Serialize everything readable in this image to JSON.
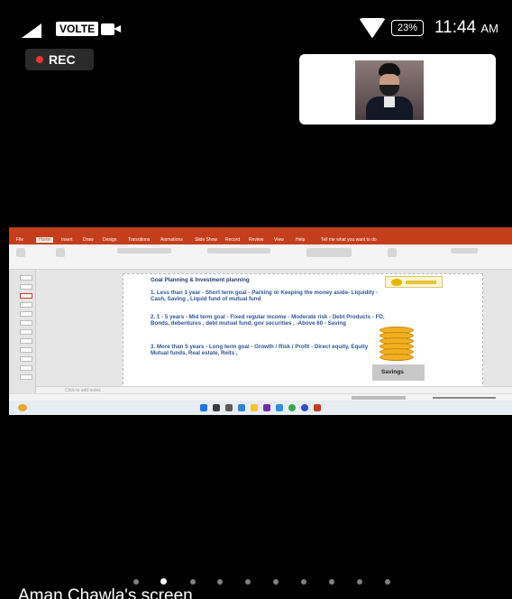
{
  "status_bar": {
    "network_badge": "VOLTE",
    "battery": "23%",
    "time": "11:44",
    "ampm": "AM"
  },
  "recording": {
    "label": "REC",
    "dot_color": "#ee3333"
  },
  "shared_screen": {
    "owner_label": "Aman Chawla's screen",
    "app": {
      "tabs": [
        "File",
        "Home",
        "Insert",
        "Draw",
        "Design",
        "Transitions",
        "Animations",
        "Slide Show",
        "Record",
        "Review",
        "View",
        "Help"
      ],
      "active_tab": "Home",
      "search_hint": "Tell me what you want to do",
      "notes_hint": "Click to add notes",
      "brand_color": "#c43e1c"
    },
    "slide": {
      "title": "Goal Planning & Investment planning",
      "points": [
        "1. Less than 1 year - Short term goal - Parking or Keeping the money aside- Liquidity - Cash, Saving , Liquid fund of mutual fund",
        "2. 1 - 5 years - Mid term goal - Fixed regular income - Moderate risk - Debt Products - FD, Bonds, debentures , debt mutual fund, gov securities , -Above 60 - Saving",
        "3. More than 5 years - Long term goal - Growth / Risk / Profit - Direct equity, Equity Mutual funds, Real estate, Reits ,"
      ],
      "image_label": "Savings"
    }
  },
  "pager": {
    "count": 12,
    "active_index": 1
  }
}
